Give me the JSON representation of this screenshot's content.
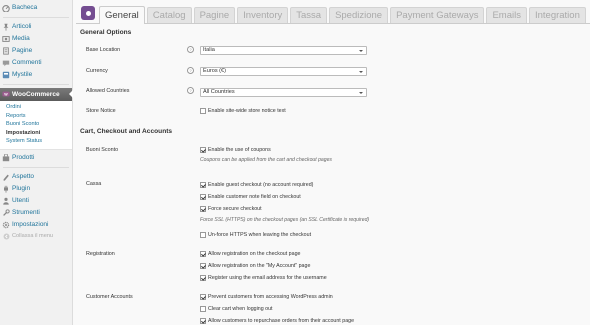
{
  "sidebar": {
    "items_top": [
      {
        "label": "Bacheca",
        "icon": "dashboard-icon"
      }
    ],
    "items_main": [
      {
        "label": "Articoli",
        "icon": "pin-icon"
      },
      {
        "label": "Media",
        "icon": "media-icon"
      },
      {
        "label": "Pagine",
        "icon": "pages-icon"
      },
      {
        "label": "Commenti",
        "icon": "comments-icon"
      },
      {
        "label": "Mystile",
        "icon": "theme-icon"
      }
    ],
    "woocommerce": {
      "label": "WooCommerce",
      "icon": "woocommerce-icon"
    },
    "submenu": [
      "Ordini",
      "Reports",
      "Buoni Sconto",
      "Impostazioni",
      "System Status"
    ],
    "submenu_current": "Impostazioni",
    "prodotti": {
      "label": "Prodotti",
      "icon": "products-icon"
    },
    "items_bottom": [
      {
        "label": "Aspetto",
        "icon": "appearance-icon"
      },
      {
        "label": "Plugin",
        "icon": "plugin-icon"
      },
      {
        "label": "Utenti",
        "icon": "users-icon"
      },
      {
        "label": "Strumenti",
        "icon": "tools-icon"
      },
      {
        "label": "Impostazioni",
        "icon": "settings-icon"
      }
    ],
    "collapse_label": "Collassa il menu"
  },
  "tabs": [
    "General",
    "Catalog",
    "Pagine",
    "Inventory",
    "Tassa",
    "Spedizione",
    "Payment Gateways",
    "Emails",
    "Integration"
  ],
  "active_tab": "General",
  "general_options": {
    "title": "General Options",
    "base_location": {
      "label": "Base Location",
      "value": "Italia"
    },
    "currency": {
      "label": "Currency",
      "value": "Euros (€)"
    },
    "allowed_countries": {
      "label": "Allowed Countries",
      "value": "All Countries"
    },
    "store_notice": {
      "label": "Store Notice",
      "checkbox": "Enable site-wide store notice text",
      "checked": false
    }
  },
  "cart": {
    "title": "Cart, Checkout and Accounts",
    "buoni_sconto": {
      "label": "Buoni Sconto",
      "checkbox": "Enable the use of coupons",
      "checked": true,
      "description": "Coupons can be applied from the cart and checkout pages"
    },
    "cassa": {
      "label": "Cassa",
      "options": [
        {
          "text": "Enable guest checkout (no account required)",
          "checked": true
        },
        {
          "text": "Enable customer note field on checkout",
          "checked": true
        },
        {
          "text": "Force secure checkout",
          "checked": true
        }
      ],
      "description": "Force SSL (HTTPS) on the checkout pages (an SSL Certificate is required)",
      "unforce": {
        "text": "Un-force HTTPS when leaving the checkout",
        "checked": false
      }
    },
    "registration": {
      "label": "Registration",
      "options": [
        {
          "text": "Allow registration on the checkout page",
          "checked": true
        },
        {
          "text": "Allow registration on the \"My Account\" page",
          "checked": true
        },
        {
          "text": "Register using the email address for the username",
          "checked": true
        }
      ]
    },
    "customer_accounts": {
      "label": "Customer Accounts",
      "options": [
        {
          "text": "Prevent customers from accessing WordPress admin",
          "checked": true
        },
        {
          "text": "Clear cart when logging out",
          "checked": false
        },
        {
          "text": "Allow customers to repurchase orders from their account page",
          "checked": true
        }
      ]
    }
  },
  "colors": {
    "accent": "#21759b",
    "woo_purple": "#744d91",
    "active_menu": "#6d6d6d"
  }
}
